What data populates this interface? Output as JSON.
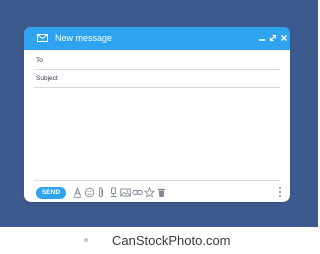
{
  "window": {
    "title": "New message"
  },
  "fields": {
    "to_label": "To",
    "subject_label": "Subject",
    "to_value": "",
    "subject_value": ""
  },
  "toolbar": {
    "send_label": "SEND",
    "icons": [
      "font-icon",
      "emoji-icon",
      "attach-icon",
      "drive-icon",
      "image-icon",
      "link-icon",
      "star-icon",
      "trash-icon",
      "more-icon"
    ]
  },
  "watermark": {
    "text": "CanStockPhoto.com"
  },
  "colors": {
    "background": "#3d5a8e",
    "accent": "#2ea3ef",
    "window": "#ffffff",
    "divider": "#d4dbe3"
  }
}
